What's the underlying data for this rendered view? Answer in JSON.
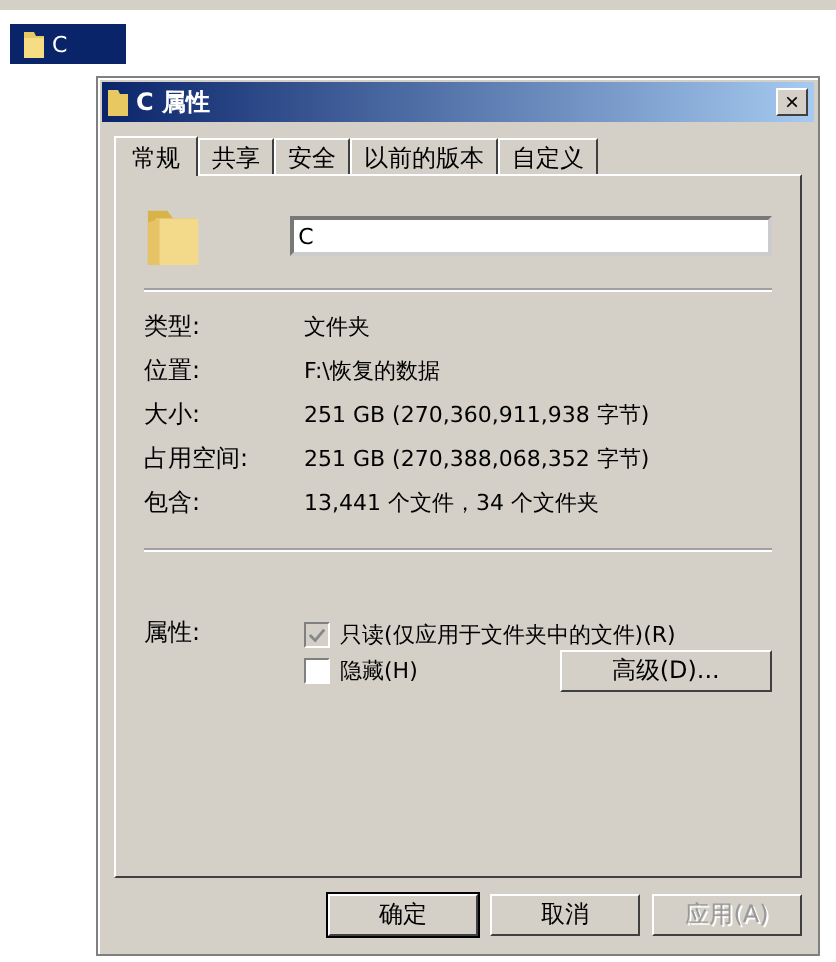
{
  "desktop_item": {
    "label": "C",
    "selected": true
  },
  "window": {
    "title": "C 属性",
    "close": "×"
  },
  "tabs": [
    {
      "label": "常规",
      "selected": true
    },
    {
      "label": "共享",
      "selected": false
    },
    {
      "label": "安全",
      "selected": false
    },
    {
      "label": "以前的版本",
      "selected": false
    },
    {
      "label": "自定义",
      "selected": false
    }
  ],
  "name_field": {
    "value": "C"
  },
  "properties": [
    {
      "label": "类型:",
      "value": "文件夹"
    },
    {
      "label": "位置:",
      "value": "F:\\恢复的数据"
    },
    {
      "label": "大小:",
      "value": "251 GB (270,360,911,938 字节)"
    },
    {
      "label": "占用空间:",
      "value": "251 GB (270,388,068,352 字节)"
    },
    {
      "label": "包含:",
      "value": "13,441 个文件，34 个文件夹"
    }
  ],
  "attributes": {
    "label": "属性:",
    "options": [
      {
        "label": "只读(仅应用于文件夹中的文件)(R)",
        "checked": true,
        "disabled": true
      },
      {
        "label": "隐藏(H)",
        "checked": false,
        "disabled": false
      }
    ],
    "advanced_button": "高级(D)..."
  },
  "buttons": [
    {
      "label": "确定",
      "disabled": false,
      "default": true
    },
    {
      "label": "取消",
      "disabled": false,
      "default": false
    },
    {
      "label": "应用(A)",
      "disabled": true,
      "default": false
    }
  ]
}
